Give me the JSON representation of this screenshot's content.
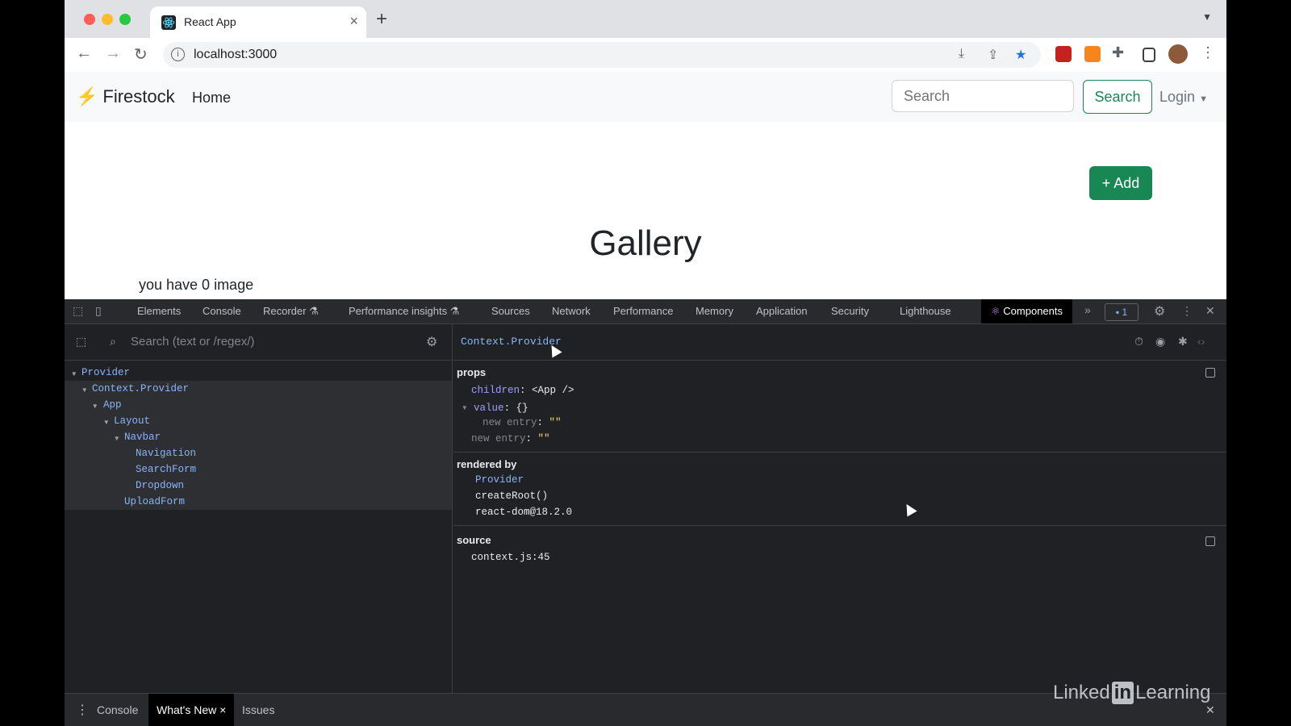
{
  "browser": {
    "tab_title": "React App",
    "url": "localhost:3000",
    "issues_count": "1"
  },
  "app": {
    "brand": "Firestock",
    "nav_home": "Home",
    "search_placeholder": "Search",
    "search_button": "Search",
    "login": "Login",
    "add_button": "+ Add",
    "gallery_title": "Gallery",
    "image_count": "you have 0 image"
  },
  "devtools": {
    "tabs": [
      "Elements",
      "Console",
      "Recorder",
      "Performance insights",
      "Sources",
      "Network",
      "Performance",
      "Memory",
      "Application",
      "Security",
      "Lighthouse",
      "Components"
    ],
    "active_tab": "Components",
    "tree_search_placeholder": "Search (text or /regex/)",
    "tree": [
      {
        "label": "Provider"
      },
      {
        "label": "Context.Provider"
      },
      {
        "label": "App"
      },
      {
        "label": "Layout"
      },
      {
        "label": "Navbar"
      },
      {
        "label": "Navigation"
      },
      {
        "label": "SearchForm"
      },
      {
        "label": "Dropdown"
      },
      {
        "label": "UploadForm"
      }
    ],
    "selected_component": "Context.Provider",
    "props_label": "props",
    "props": {
      "children_key": "children",
      "children_value": "<App />",
      "value_key": "value",
      "value_value": "{}",
      "entry1_key": "new entry",
      "entry1_value": "\"\"",
      "entry2_key": "new entry",
      "entry2_value": "\"\""
    },
    "rendered_by_label": "rendered by",
    "rendered_by": [
      "Provider",
      "createRoot()",
      "react-dom@18.2.0"
    ],
    "source_label": "source",
    "source": "context.js:45",
    "drawer_tabs": [
      "Console",
      "What's New",
      "Issues"
    ]
  },
  "watermark": {
    "pre": "Linked",
    "in": "in",
    "post": "Learning"
  }
}
